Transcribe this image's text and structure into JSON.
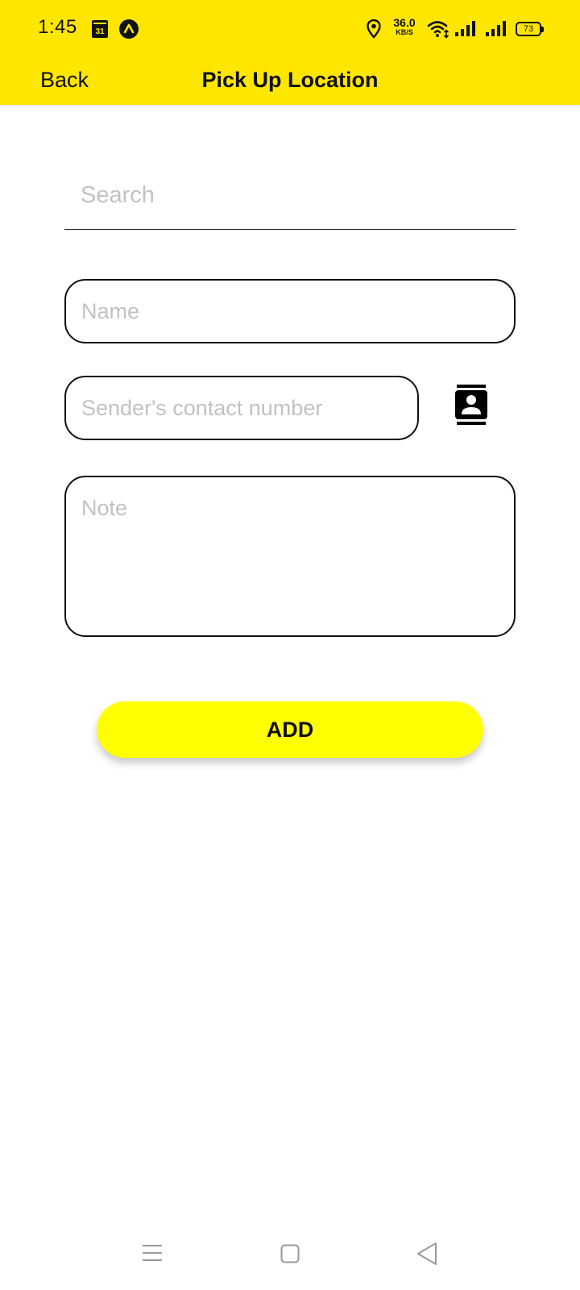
{
  "status_bar": {
    "time": "1:45",
    "calendar_day": "31",
    "net_speed_value": "36.0",
    "net_speed_unit": "KB/S",
    "battery": "73"
  },
  "header": {
    "back_label": "Back",
    "title": "Pick Up Location",
    "background_color": "#ffe600"
  },
  "form": {
    "search_placeholder": "Search",
    "name_placeholder": "Name",
    "phone_placeholder": "Sender's contact number",
    "note_placeholder": "Note",
    "add_label": "ADD",
    "add_button_color": "#ffff00"
  },
  "icons": {
    "contacts": "contacts-icon",
    "nav_menu": "menu-icon",
    "nav_home": "home-square-icon",
    "nav_back": "back-triangle-icon"
  }
}
